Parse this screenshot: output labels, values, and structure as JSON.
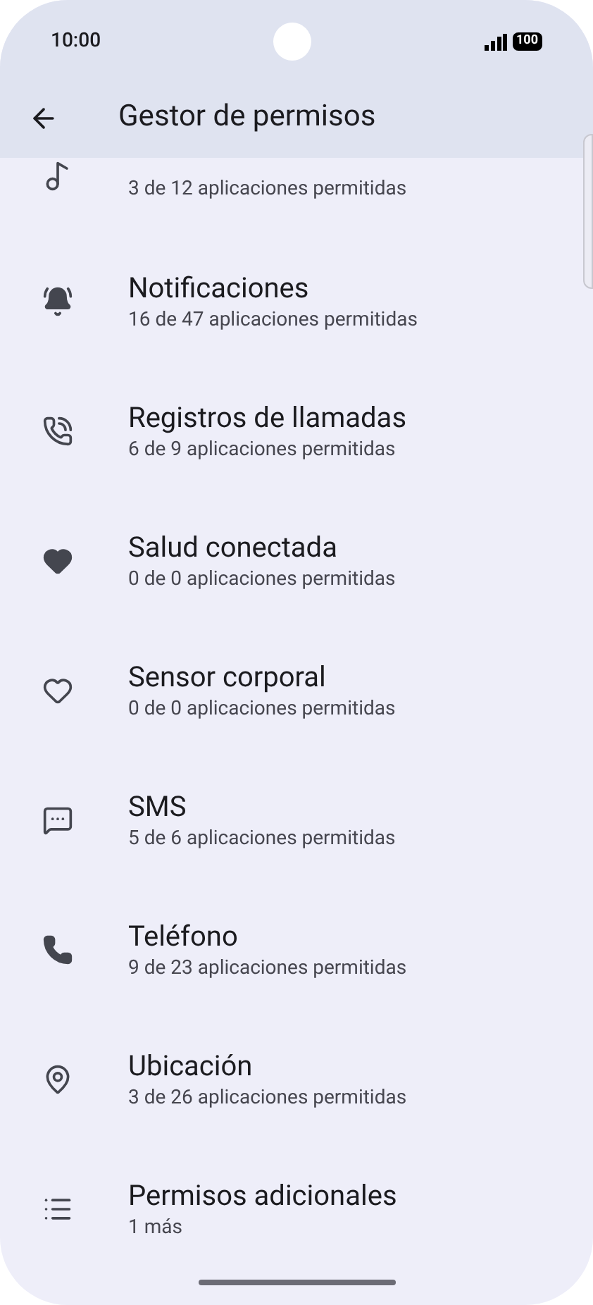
{
  "status_bar": {
    "time": "10:00",
    "battery": "100"
  },
  "toolbar": {
    "title": "Gestor de permisos"
  },
  "permissions": [
    {
      "kind": "music",
      "subtitle": "3 de 12 aplicaciones permitidas"
    },
    {
      "kind": "notifications",
      "title": "Notificaciones",
      "subtitle": "16 de 47 aplicaciones permitidas"
    },
    {
      "kind": "call_log",
      "title": "Registros de llamadas",
      "subtitle": "6 de 9 aplicaciones permitidas"
    },
    {
      "kind": "health",
      "title": "Salud conectada",
      "subtitle": "0 de 0 aplicaciones permitidas"
    },
    {
      "kind": "body",
      "title": "Sensor corporal",
      "subtitle": "0 de 0 aplicaciones permitidas"
    },
    {
      "kind": "sms",
      "title": "SMS",
      "subtitle": "5 de 6 aplicaciones permitidas"
    },
    {
      "kind": "phone",
      "title": "Teléfono",
      "subtitle": "9 de 23 aplicaciones permitidas"
    },
    {
      "kind": "location",
      "title": "Ubicación",
      "subtitle": "3 de 26 aplicaciones permitidas"
    },
    {
      "kind": "more",
      "title": "Permisos adicionales",
      "subtitle": "1 más"
    }
  ]
}
